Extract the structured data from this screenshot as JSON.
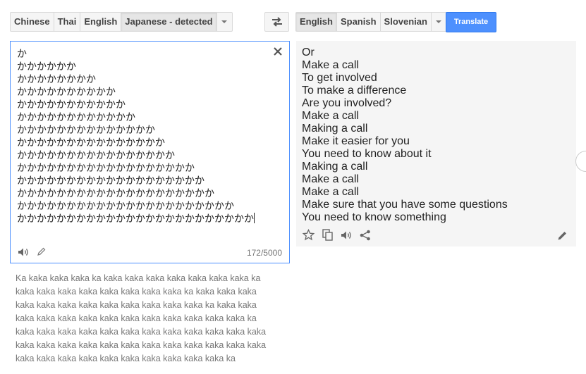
{
  "source_languages": [
    {
      "label": "Chinese",
      "active": false
    },
    {
      "label": "Thai",
      "active": false
    },
    {
      "label": "English",
      "active": false
    },
    {
      "label": "Japanese - detected",
      "active": true
    }
  ],
  "target_languages": [
    {
      "label": "English",
      "active": true
    },
    {
      "label": "Spanish",
      "active": false
    },
    {
      "label": "Slovenian",
      "active": false
    }
  ],
  "translate_label": "Translate",
  "source": {
    "lines": [
      "か",
      "かかかかかか",
      "かかかかかかかか",
      "かかかかかかかかかか",
      "かかかかかかかかかかか",
      "かかかかかかかかかかかか",
      "かかかかかかかかかかかかかか",
      "かかかかかかかかかかかかかかか",
      "かかかかかかかかかかかかかかかか",
      "かかかかかかかかかかかかかかかかかか",
      "かかかかかかかかかかかかかかかかかかか",
      "かかかかかかかかかかかかかかかかかかかか",
      "かかかかかかかかかかかかかかかかかかかかかか",
      "かかかかかかかかかかかかかかかかかかかかかかかか"
    ],
    "char_count": "172/5000"
  },
  "translation": {
    "lines": [
      "Or",
      "Make a call",
      "To get involved",
      "To make a difference",
      "Are you involved?",
      "Make a call",
      "Making a call",
      "Make it easier for you",
      "You need to know about it",
      "Making a call",
      "Make a call",
      "Make a call",
      "Make sure that you have some questions",
      "You need to know something"
    ]
  },
  "romanization": {
    "lines": [
      "Ka kaka kaka kaka ka kaka kaka kaka kaka kaka kaka kaka ka",
      "kaka kaka kaka kaka kaka kaka kaka kaka ka kaka kaka kaka",
      "kaka kaka kaka kaka kaka kaka kaka kaka kaka ka kaka kaka",
      "kaka kaka kaka kaka kaka kaka kaka kaka kaka kaka kaka ka",
      "kaka kaka kaka kaka kaka kaka kaka kaka kaka kaka kaka kaka",
      "kaka kaka kaka kaka kaka kaka kaka kaka kaka kaka kaka kaka",
      "kaka kaka kaka kaka kaka kaka kaka kaka kaka kaka ka"
    ]
  },
  "icons": {
    "swap": "swap-languages-icon",
    "clear": "close-icon",
    "speaker": "speaker-icon",
    "pencil": "pencil-icon",
    "star": "star-icon",
    "copy": "copy-icon",
    "share": "share-icon",
    "dropdown": "chevron-down-icon"
  },
  "colors": {
    "accent": "#4d90fe",
    "source_border": "#4d90fe",
    "result_bg": "#f5f5f5"
  }
}
